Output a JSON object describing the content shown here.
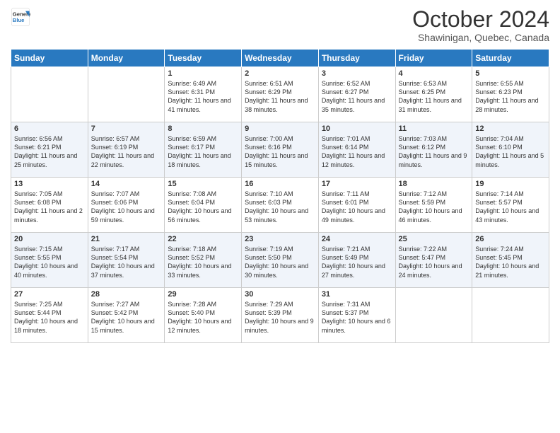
{
  "logo": {
    "line1": "General",
    "line2": "Blue"
  },
  "title": "October 2024",
  "subtitle": "Shawinigan, Quebec, Canada",
  "headers": [
    "Sunday",
    "Monday",
    "Tuesday",
    "Wednesday",
    "Thursday",
    "Friday",
    "Saturday"
  ],
  "weeks": [
    [
      {
        "day": "",
        "info": ""
      },
      {
        "day": "",
        "info": ""
      },
      {
        "day": "1",
        "info": "Sunrise: 6:49 AM\nSunset: 6:31 PM\nDaylight: 11 hours and 41 minutes."
      },
      {
        "day": "2",
        "info": "Sunrise: 6:51 AM\nSunset: 6:29 PM\nDaylight: 11 hours and 38 minutes."
      },
      {
        "day": "3",
        "info": "Sunrise: 6:52 AM\nSunset: 6:27 PM\nDaylight: 11 hours and 35 minutes."
      },
      {
        "day": "4",
        "info": "Sunrise: 6:53 AM\nSunset: 6:25 PM\nDaylight: 11 hours and 31 minutes."
      },
      {
        "day": "5",
        "info": "Sunrise: 6:55 AM\nSunset: 6:23 PM\nDaylight: 11 hours and 28 minutes."
      }
    ],
    [
      {
        "day": "6",
        "info": "Sunrise: 6:56 AM\nSunset: 6:21 PM\nDaylight: 11 hours and 25 minutes."
      },
      {
        "day": "7",
        "info": "Sunrise: 6:57 AM\nSunset: 6:19 PM\nDaylight: 11 hours and 22 minutes."
      },
      {
        "day": "8",
        "info": "Sunrise: 6:59 AM\nSunset: 6:17 PM\nDaylight: 11 hours and 18 minutes."
      },
      {
        "day": "9",
        "info": "Sunrise: 7:00 AM\nSunset: 6:16 PM\nDaylight: 11 hours and 15 minutes."
      },
      {
        "day": "10",
        "info": "Sunrise: 7:01 AM\nSunset: 6:14 PM\nDaylight: 11 hours and 12 minutes."
      },
      {
        "day": "11",
        "info": "Sunrise: 7:03 AM\nSunset: 6:12 PM\nDaylight: 11 hours and 9 minutes."
      },
      {
        "day": "12",
        "info": "Sunrise: 7:04 AM\nSunset: 6:10 PM\nDaylight: 11 hours and 5 minutes."
      }
    ],
    [
      {
        "day": "13",
        "info": "Sunrise: 7:05 AM\nSunset: 6:08 PM\nDaylight: 11 hours and 2 minutes."
      },
      {
        "day": "14",
        "info": "Sunrise: 7:07 AM\nSunset: 6:06 PM\nDaylight: 10 hours and 59 minutes."
      },
      {
        "day": "15",
        "info": "Sunrise: 7:08 AM\nSunset: 6:04 PM\nDaylight: 10 hours and 56 minutes."
      },
      {
        "day": "16",
        "info": "Sunrise: 7:10 AM\nSunset: 6:03 PM\nDaylight: 10 hours and 53 minutes."
      },
      {
        "day": "17",
        "info": "Sunrise: 7:11 AM\nSunset: 6:01 PM\nDaylight: 10 hours and 49 minutes."
      },
      {
        "day": "18",
        "info": "Sunrise: 7:12 AM\nSunset: 5:59 PM\nDaylight: 10 hours and 46 minutes."
      },
      {
        "day": "19",
        "info": "Sunrise: 7:14 AM\nSunset: 5:57 PM\nDaylight: 10 hours and 43 minutes."
      }
    ],
    [
      {
        "day": "20",
        "info": "Sunrise: 7:15 AM\nSunset: 5:55 PM\nDaylight: 10 hours and 40 minutes."
      },
      {
        "day": "21",
        "info": "Sunrise: 7:17 AM\nSunset: 5:54 PM\nDaylight: 10 hours and 37 minutes."
      },
      {
        "day": "22",
        "info": "Sunrise: 7:18 AM\nSunset: 5:52 PM\nDaylight: 10 hours and 33 minutes."
      },
      {
        "day": "23",
        "info": "Sunrise: 7:19 AM\nSunset: 5:50 PM\nDaylight: 10 hours and 30 minutes."
      },
      {
        "day": "24",
        "info": "Sunrise: 7:21 AM\nSunset: 5:49 PM\nDaylight: 10 hours and 27 minutes."
      },
      {
        "day": "25",
        "info": "Sunrise: 7:22 AM\nSunset: 5:47 PM\nDaylight: 10 hours and 24 minutes."
      },
      {
        "day": "26",
        "info": "Sunrise: 7:24 AM\nSunset: 5:45 PM\nDaylight: 10 hours and 21 minutes."
      }
    ],
    [
      {
        "day": "27",
        "info": "Sunrise: 7:25 AM\nSunset: 5:44 PM\nDaylight: 10 hours and 18 minutes."
      },
      {
        "day": "28",
        "info": "Sunrise: 7:27 AM\nSunset: 5:42 PM\nDaylight: 10 hours and 15 minutes."
      },
      {
        "day": "29",
        "info": "Sunrise: 7:28 AM\nSunset: 5:40 PM\nDaylight: 10 hours and 12 minutes."
      },
      {
        "day": "30",
        "info": "Sunrise: 7:29 AM\nSunset: 5:39 PM\nDaylight: 10 hours and 9 minutes."
      },
      {
        "day": "31",
        "info": "Sunrise: 7:31 AM\nSunset: 5:37 PM\nDaylight: 10 hours and 6 minutes."
      },
      {
        "day": "",
        "info": ""
      },
      {
        "day": "",
        "info": ""
      }
    ]
  ]
}
